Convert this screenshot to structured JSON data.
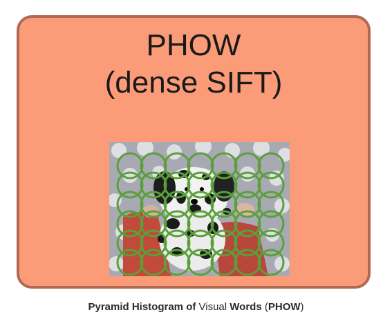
{
  "card": {
    "title_line1": "PHOW",
    "title_line2": "(dense SIFT)"
  },
  "caption": {
    "p1": "Pyramid Histogram ",
    "p2": "of ",
    "p3": "Visual ",
    "p4": "Words",
    "p5": " (",
    "p6": "PHOW",
    "p7": ")"
  },
  "colors": {
    "card_fill": "#fb9b78",
    "card_border": "#b06a54",
    "grid_circles": "#5aa03a"
  },
  "grid": {
    "rows": 6,
    "cols": 7
  }
}
